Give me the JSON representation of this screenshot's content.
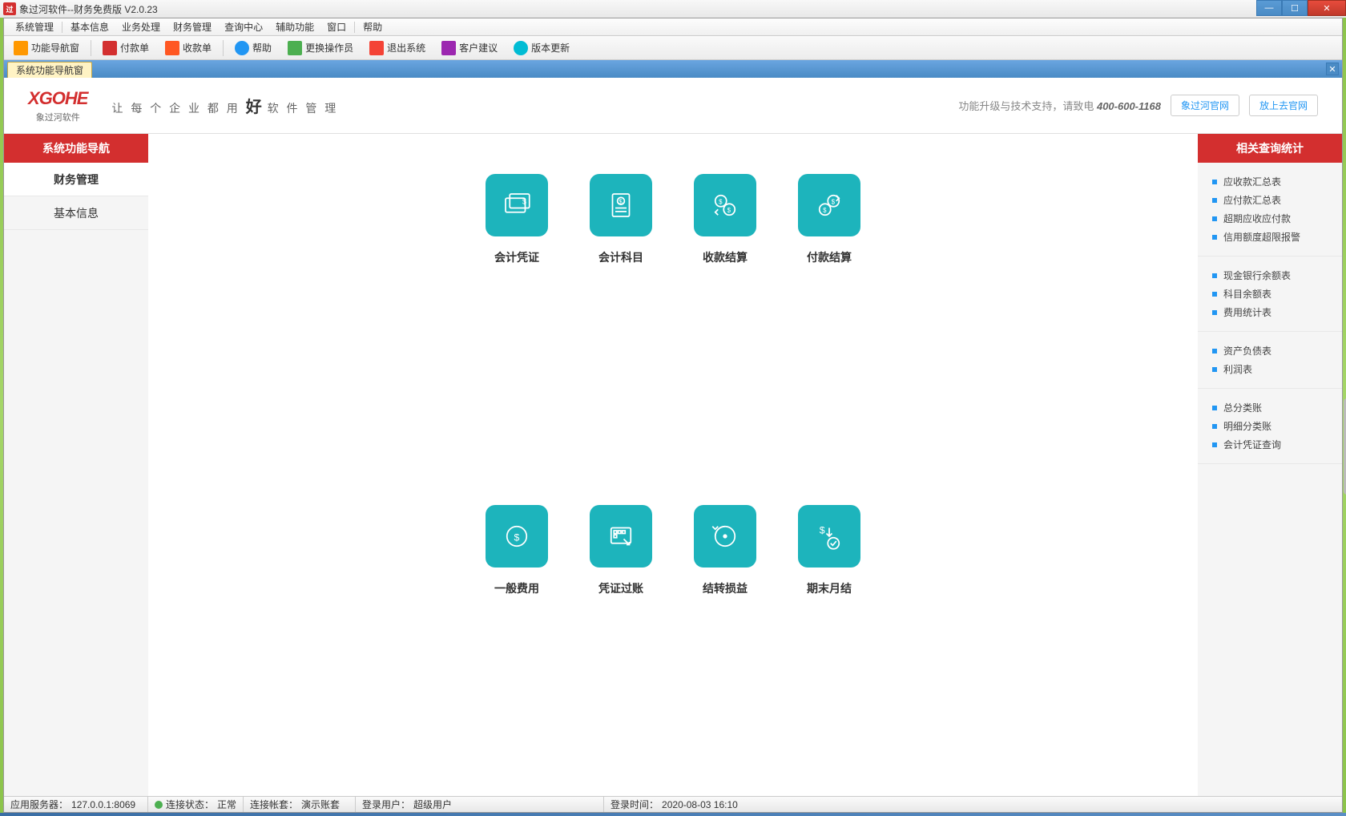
{
  "window": {
    "title": "象过河软件--财务免费版 V2.0.23"
  },
  "menubar": [
    "系统管理",
    "基本信息",
    "业务处理",
    "财务管理",
    "查询中心",
    "辅助功能",
    "窗口",
    "帮助"
  ],
  "toolbar": [
    {
      "icon": "home",
      "label": "功能导航窗"
    },
    {
      "icon": "pay",
      "label": "付款单"
    },
    {
      "icon": "rcv",
      "label": "收款单"
    },
    {
      "icon": "help",
      "label": "帮助"
    },
    {
      "icon": "user",
      "label": "更换操作员"
    },
    {
      "icon": "exit",
      "label": "退出系统"
    },
    {
      "icon": "sug",
      "label": "客户建议"
    },
    {
      "icon": "ver",
      "label": "版本更新"
    }
  ],
  "tab": {
    "active": "系统功能导航窗"
  },
  "brand": {
    "logo": "XGOHE",
    "logo_sub": "象过河软件",
    "slogan_pre": "让 每 个 企 业 都 用",
    "slogan_hl": "好",
    "slogan_post": "软 件 管 理",
    "support": "功能升级与技术支持，请致电",
    "tel": "400-600-1168",
    "link1": "象过河官网",
    "link2": "放上去官网"
  },
  "sidebar_left": {
    "header": "系统功能导航",
    "items": [
      {
        "label": "财务管理",
        "active": true
      },
      {
        "label": "基本信息",
        "active": false
      }
    ]
  },
  "grid": [
    {
      "label": "会计凭证",
      "icon": "voucher"
    },
    {
      "label": "会计科目",
      "icon": "subject"
    },
    {
      "label": "收款结算",
      "icon": "receive"
    },
    {
      "label": "付款结算",
      "icon": "payment"
    },
    {
      "label": "一般费用",
      "icon": "expense"
    },
    {
      "label": "凭证过账",
      "icon": "posting"
    },
    {
      "label": "结转损益",
      "icon": "carryover"
    },
    {
      "label": "期末月结",
      "icon": "monthend"
    }
  ],
  "sidebar_right": {
    "header": "相关查询统计",
    "groups": [
      [
        "应收款汇总表",
        "应付款汇总表",
        "超期应收应付款",
        "信用额度超限报警"
      ],
      [
        "现金银行余额表",
        "科目余额表",
        "费用统计表"
      ],
      [
        "资产负债表",
        "利润表"
      ],
      [
        "总分类账",
        "明细分类账",
        "会计凭证查询"
      ]
    ]
  },
  "statusbar": {
    "server_label": "应用服务器：",
    "server": "127.0.0.1:8069",
    "conn_label": "连接状态：",
    "conn": "正常",
    "book_label": "连接帐套：",
    "book": "演示账套",
    "user_label": "登录用户：",
    "user": "超级用户",
    "time_label": "登录时间：",
    "time": "2020-08-03 16:10"
  }
}
